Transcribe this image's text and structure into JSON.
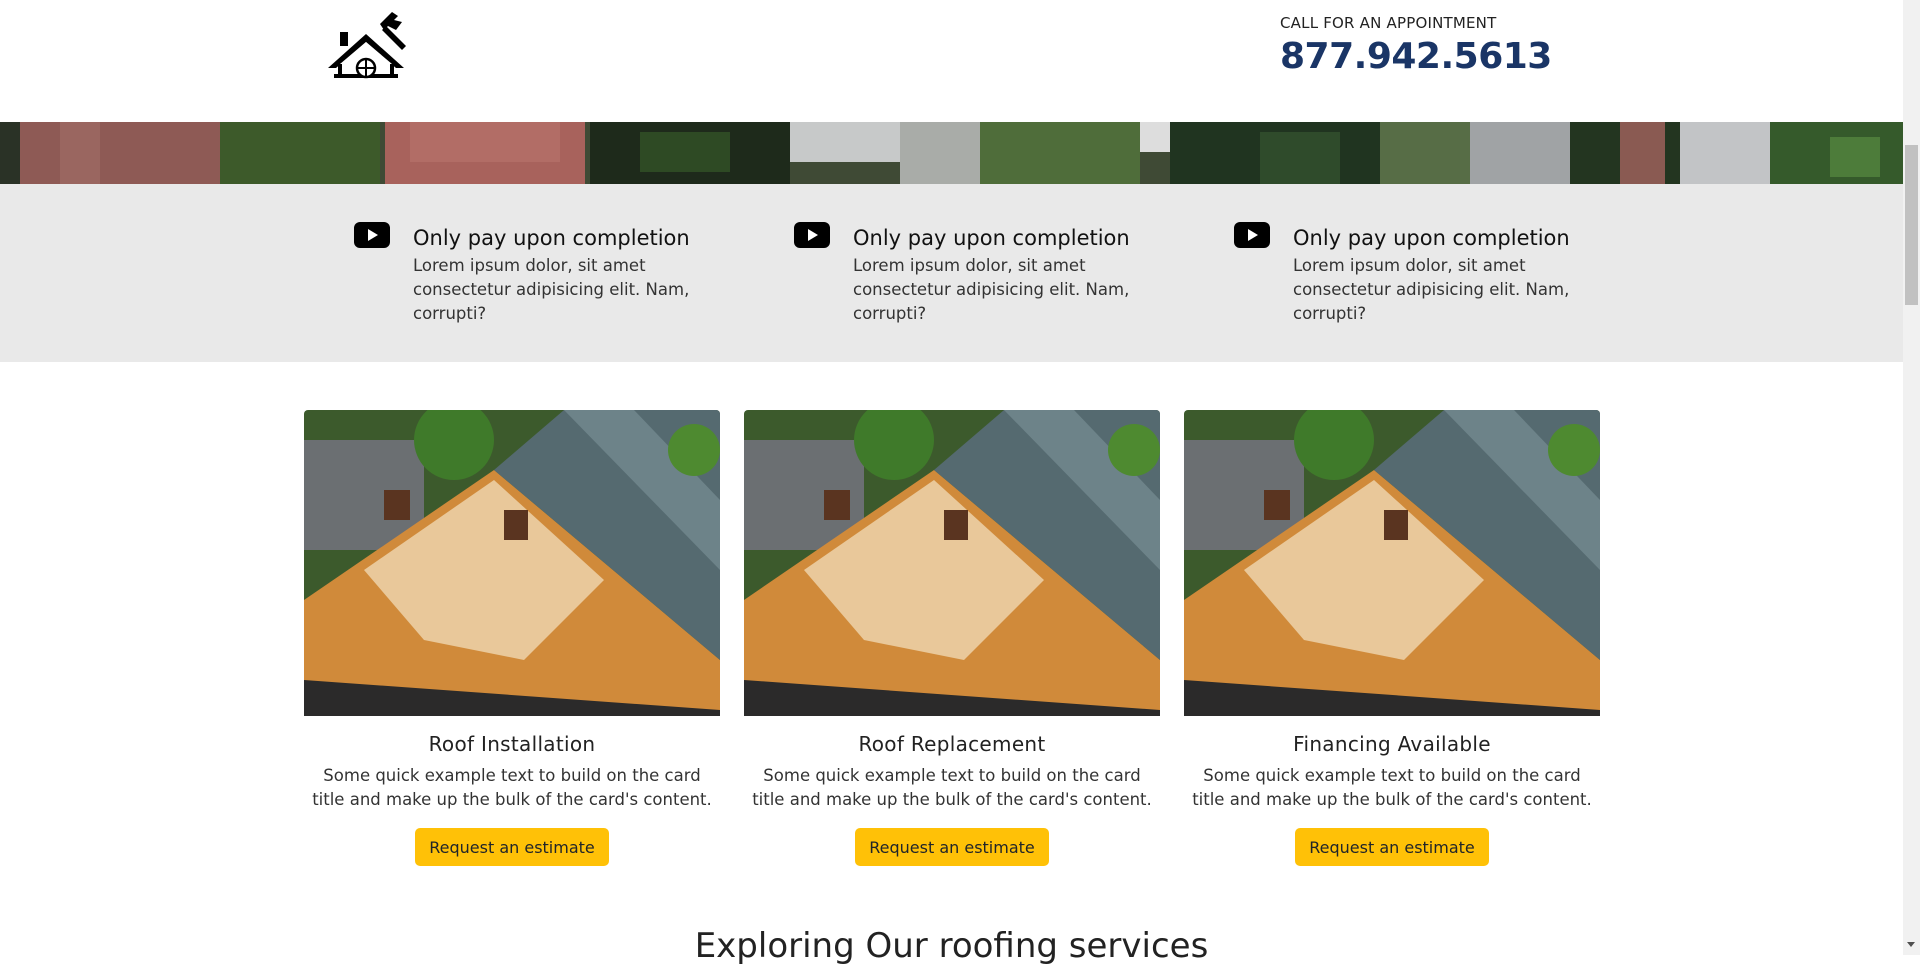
{
  "header": {
    "call_label": "CALL FOR AN APPOINTMENT",
    "phone": "877.942.5613"
  },
  "features": [
    {
      "icon": "youtube-icon",
      "title": "Only pay upon completion",
      "body": "Lorem ipsum dolor, sit amet consectetur adipisicing elit. Nam, corrupti?"
    },
    {
      "icon": "youtube-icon",
      "title": "Only pay upon completion",
      "body": "Lorem ipsum dolor, sit amet consectetur adipisicing elit. Nam, corrupti?"
    },
    {
      "icon": "youtube-icon",
      "title": "Only pay upon completion",
      "body": "Lorem ipsum dolor, sit amet consectetur adipisicing elit. Nam, corrupti?"
    }
  ],
  "cards": [
    {
      "title": "Roof Installation",
      "text": "Some quick example text to build on the card title and make up the bulk of the card's content.",
      "button": "Request an estimate"
    },
    {
      "title": "Roof Replacement",
      "text": "Some quick example text to build on the card title and make up the bulk of the card's content.",
      "button": "Request an estimate"
    },
    {
      "title": "Financing Available",
      "text": "Some quick example text to build on the card title and make up the bulk of the card's content.",
      "button": "Request an estimate"
    }
  ],
  "section_heading": "Exploring Our roofing services",
  "colors": {
    "accent_button": "#ffc107",
    "phone_text": "#1a3566",
    "features_bg": "#e9e9e9"
  }
}
